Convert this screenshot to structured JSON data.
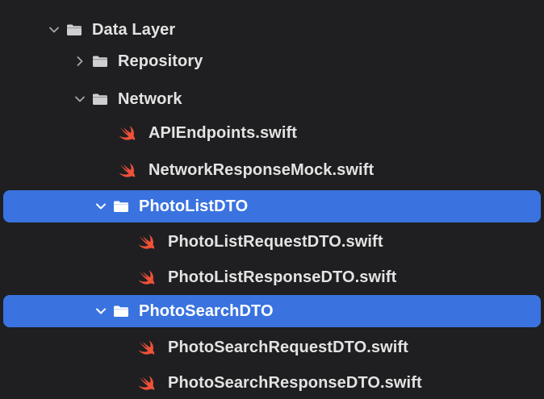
{
  "tree": {
    "data_layer": {
      "label": "Data Layer",
      "expanded": true
    },
    "repository": {
      "label": "Repository",
      "expanded": false
    },
    "network": {
      "label": "Network",
      "expanded": true
    },
    "api_endpoints": {
      "label": "APIEndpoints.swift"
    },
    "network_response_mock": {
      "label": "NetworkResponseMock.swift"
    },
    "photo_list_dto": {
      "label": "PhotoListDTO",
      "expanded": true,
      "selected": true
    },
    "photo_list_request": {
      "label": "PhotoListRequestDTO.swift"
    },
    "photo_list_response": {
      "label": "PhotoListResponseDTO.swift"
    },
    "photo_search_dto": {
      "label": "PhotoSearchDTO",
      "expanded": true,
      "selected": true
    },
    "photo_search_request": {
      "label": "PhotoSearchRequestDTO.swift"
    },
    "photo_search_response": {
      "label": "PhotoSearchResponseDTO.swift"
    }
  },
  "icons": {
    "folder": "folder-icon",
    "swift": "swift-file-icon",
    "chevron_down": "chevron-down-icon",
    "chevron_right": "chevron-right-icon"
  },
  "colors": {
    "background": "#1f1f21",
    "selection": "#3a73df",
    "swift_orange": "#f05138",
    "folder_gray": "#cfcfd2",
    "folder_white": "#ffffff",
    "text": "#e3e3e3"
  }
}
